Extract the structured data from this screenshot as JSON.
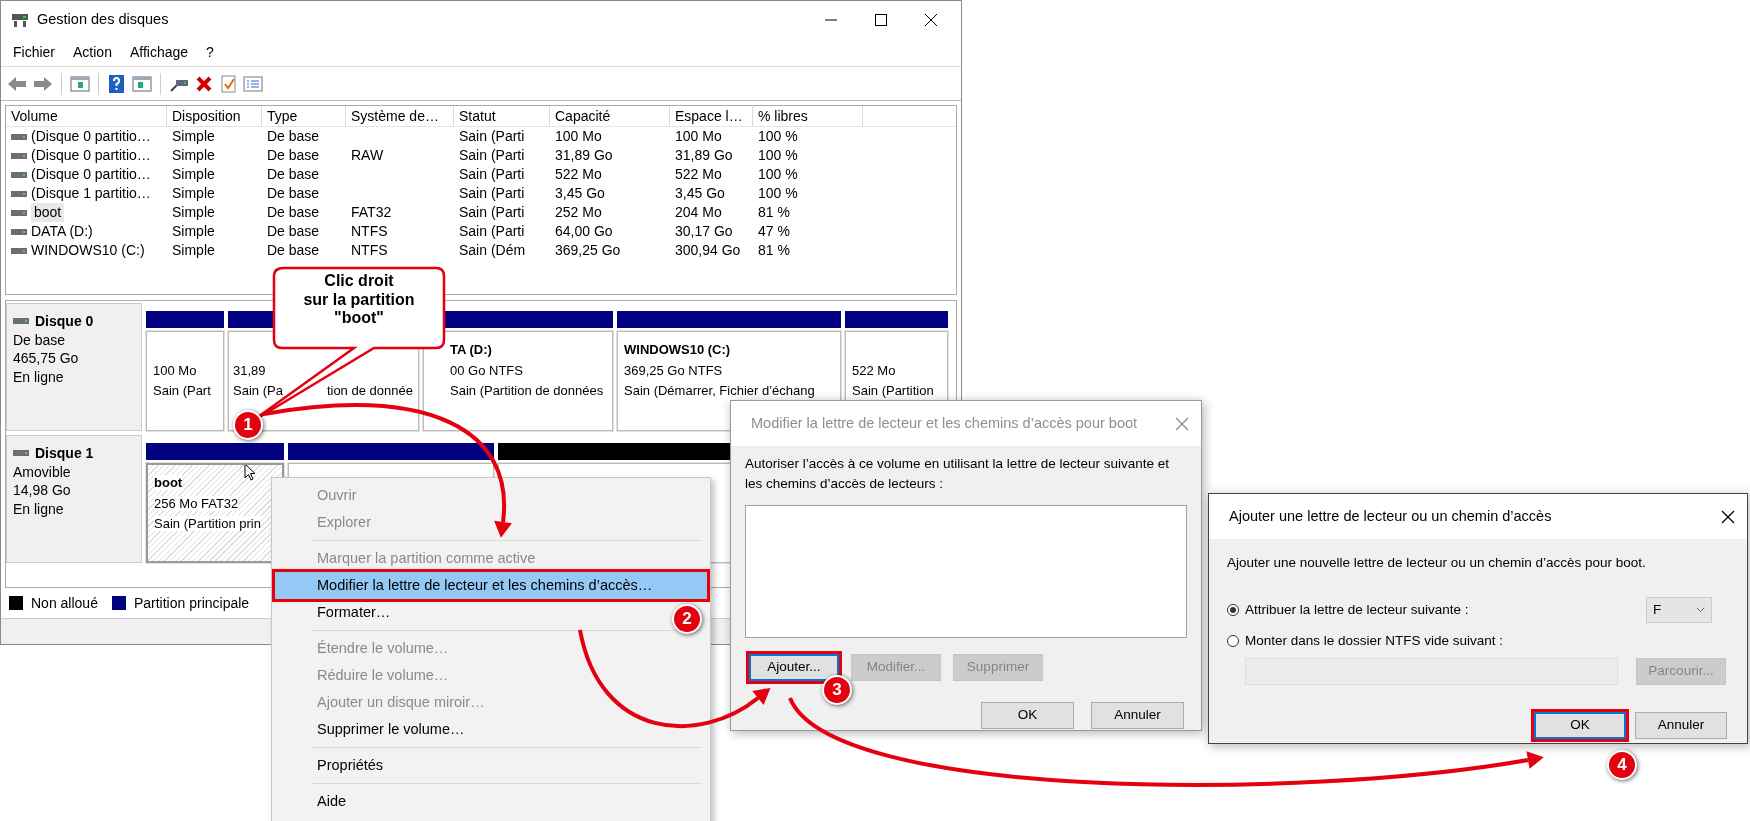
{
  "window": {
    "title": "Gestion des disques"
  },
  "menu": [
    "Fichier",
    "Action",
    "Affichage",
    "?"
  ],
  "table": {
    "columns": [
      "Volume",
      "Disposition",
      "Type",
      "Système de…",
      "Statut",
      "Capacité",
      "Espace l…",
      "% libres"
    ],
    "rows": [
      {
        "selected": false,
        "volume": "(Disque 0 partitio…",
        "layout": "Simple",
        "type": "De base",
        "status": "Sain (Parti",
        "capacity": "100 Mo",
        "free_space": "100 Mo",
        "percent_free": "100 %"
      },
      {
        "selected": false,
        "volume": "(Disque 0 partitio…",
        "layout": "Simple",
        "type": "De base",
        "file_system": "RAW",
        "status": "Sain (Parti",
        "capacity": "31,89 Go",
        "free_space": "31,89 Go",
        "percent_free": "100 %"
      },
      {
        "selected": false,
        "volume": "(Disque 0 partitio…",
        "layout": "Simple",
        "type": "De base",
        "status": "Sain (Parti",
        "capacity": "522 Mo",
        "free_space": "522 Mo",
        "percent_free": "100 %"
      },
      {
        "selected": false,
        "volume": "(Disque 1 partitio…",
        "layout": "Simple",
        "type": "De base",
        "status": "Sain (Parti",
        "capacity": "3,45 Go",
        "free_space": "3,45 Go",
        "percent_free": "100 %"
      },
      {
        "selected": true,
        "volume": "boot",
        "layout": "Simple",
        "type": "De base",
        "file_system": "FAT32",
        "status": "Sain (Parti",
        "capacity": "252 Mo",
        "free_space": "204 Mo",
        "percent_free": "81 %"
      },
      {
        "selected": false,
        "volume": "DATA (D:)",
        "layout": "Simple",
        "type": "De base",
        "file_system": "NTFS",
        "status": "Sain (Parti",
        "capacity": "64,00 Go",
        "free_space": "30,17 Go",
        "percent_free": "47 %"
      },
      {
        "selected": false,
        "volume": "WINDOWS10 (C:)",
        "layout": "Simple",
        "type": "De base",
        "file_system": "NTFS",
        "status": "Sain (Dém",
        "capacity": "369,25 Go",
        "free_space": "300,94 Go",
        "percent_free": "81 %"
      }
    ]
  },
  "disks": [
    {
      "name": "Disque 0",
      "type": "De base",
      "size": "465,75 Go",
      "state": "En ligne",
      "partitions": [
        {
          "kind": "primary",
          "selected": false,
          "size": "100 Mo",
          "status": "Sain (Part"
        },
        {
          "kind": "primary",
          "selected": false,
          "size": "31,89",
          "status": [
            "Sain (Pa",
            "tion de donnée"
          ]
        },
        {
          "kind": "primary",
          "selected": false,
          "name": "TA  (D:)",
          "size": "00 Go NTFS",
          "status": "Sain (Partition de données"
        },
        {
          "kind": "primary",
          "selected": false,
          "name": "WINDOWS10  (C:)",
          "size": "369,25 Go NTFS",
          "status": "Sain (Démarrer, Fichier d’échang"
        },
        {
          "kind": "primary",
          "selected": false,
          "size": "522 Mo",
          "status": "Sain (Partition"
        }
      ]
    },
    {
      "name": "Disque 1",
      "type": "Amovible",
      "size": "14,98 Go",
      "state": "En ligne",
      "partitions": [
        {
          "kind": "primary",
          "selected": true,
          "name": "boot",
          "size": "256 Mo FAT32",
          "status": "Sain (Partition prin"
        },
        {
          "kind": "primary",
          "selected": false
        },
        {
          "kind": "unallocated",
          "selected": false
        }
      ]
    }
  ],
  "legend": [
    {
      "label": "Non alloué",
      "color": "#000000"
    },
    {
      "label": "Partition principale",
      "color": "#000080"
    }
  ],
  "callout": {
    "lines": [
      "Clic droit",
      "sur la partition",
      "\"boot\""
    ]
  },
  "context_menu": [
    {
      "label": "Ouvrir",
      "disabled": true,
      "highlighted": false,
      "separator_before": false
    },
    {
      "label": "Explorer",
      "disabled": true,
      "highlighted": false,
      "separator_before": false
    },
    {
      "label": "Marquer la partition comme active",
      "disabled": true,
      "highlighted": false,
      "separator_before": true
    },
    {
      "label": "Modifier la lettre de lecteur et les chemins d’accès…",
      "disabled": false,
      "highlighted": true,
      "separator_before": false
    },
    {
      "label": "Formater…",
      "disabled": false,
      "highlighted": false,
      "separator_before": false
    },
    {
      "label": "Étendre le volume…",
      "disabled": true,
      "highlighted": false,
      "separator_before": true
    },
    {
      "label": "Réduire le volume…",
      "disabled": true,
      "highlighted": false,
      "separator_before": false
    },
    {
      "label": "Ajouter un disque miroir…",
      "disabled": true,
      "highlighted": false,
      "separator_before": false
    },
    {
      "label": "Supprimer le volume…",
      "disabled": false,
      "highlighted": false,
      "separator_before": false
    },
    {
      "label": "Propriétés",
      "disabled": false,
      "highlighted": false,
      "separator_before": true
    },
    {
      "label": "Aide",
      "disabled": false,
      "highlighted": false,
      "separator_before": true
    }
  ],
  "modify_dialog": {
    "title": "Modifier la lettre de lecteur et les chemins d’accès pour boot",
    "active": false,
    "description": "Autoriser l’accès à ce volume en utilisant la lettre de lecteur suivante et les chemins d’accès de lecteurs :",
    "buttons": [
      {
        "label": "Ajouter...",
        "disabled": false,
        "highlighted": true
      },
      {
        "label": "Modifier...",
        "disabled": true,
        "highlighted": false
      },
      {
        "label": "Supprimer",
        "disabled": true,
        "highlighted": false
      }
    ],
    "footer": [
      {
        "label": "OK",
        "disabled": false,
        "highlighted": false
      },
      {
        "label": "Annuler",
        "disabled": false,
        "highlighted": false
      }
    ]
  },
  "add_dialog": {
    "title": "Ajouter une lettre de lecteur ou un chemin d’accès",
    "active": true,
    "description": "Ajouter une nouvelle lettre de lecteur ou un chemin d’accès pour boot.",
    "options": [
      {
        "kind": "letter",
        "label": "Attribuer la lettre de lecteur suivante :",
        "selected": true,
        "value": "F"
      },
      {
        "kind": "folder",
        "label": "Monter dans le dossier NTFS vide suivant :",
        "selected": false
      }
    ],
    "browse": {
      "label": "Parcourir...",
      "disabled": true
    },
    "footer": [
      {
        "label": "OK",
        "disabled": false,
        "highlighted": true
      },
      {
        "label": "Annuler",
        "disabled": false,
        "highlighted": false
      }
    ]
  },
  "steps": [
    "1",
    "2",
    "3",
    "4"
  ]
}
